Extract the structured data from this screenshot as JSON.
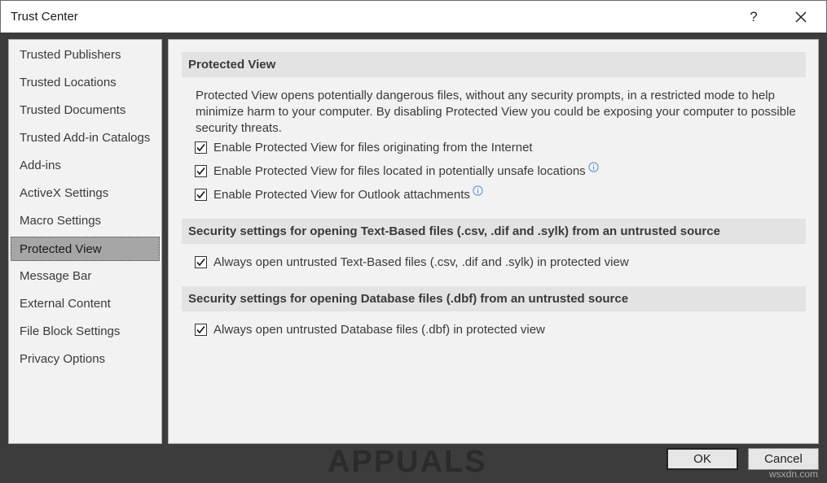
{
  "window": {
    "title": "Trust Center",
    "help_label": "?"
  },
  "sidebar": {
    "items": [
      {
        "label": "Trusted Publishers"
      },
      {
        "label": "Trusted Locations"
      },
      {
        "label": "Trusted Documents"
      },
      {
        "label": "Trusted Add-in Catalogs"
      },
      {
        "label": "Add-ins"
      },
      {
        "label": "ActiveX Settings"
      },
      {
        "label": "Macro Settings"
      },
      {
        "label": "Protected View",
        "selected": true
      },
      {
        "label": "Message Bar"
      },
      {
        "label": "External Content"
      },
      {
        "label": "File Block Settings"
      },
      {
        "label": "Privacy Options"
      }
    ]
  },
  "protected_view": {
    "header": "Protected View",
    "description": "Protected View opens potentially dangerous files, without any security prompts, in a restricted mode to help minimize harm to your computer. By disabling Protected View you could be exposing your computer to possible security threats.",
    "options": [
      {
        "label": "Enable Protected View for files originating from the Internet",
        "checked": true
      },
      {
        "label": "Enable Protected View for files located in potentially unsafe locations",
        "checked": true,
        "info_icon": "info-icon"
      },
      {
        "label": "Enable Protected View for Outlook attachments",
        "checked": true,
        "info_icon": "info-icon"
      }
    ]
  },
  "text_based": {
    "header": "Security settings for opening Text-Based files (.csv, .dif and .sylk) from an untrusted source",
    "option": {
      "label": "Always open untrusted Text-Based files (.csv, .dif and .sylk) in protected view",
      "checked": true
    }
  },
  "database": {
    "header": "Security settings for opening Database files (.dbf) from an untrusted source",
    "option": {
      "label": "Always open untrusted Database files (.dbf) in protected view",
      "checked": true
    }
  },
  "buttons": {
    "ok": "OK",
    "cancel": "Cancel"
  },
  "logo_text": "APPUALS",
  "watermark": "wsxdn.com",
  "colors": {
    "selected_item_bg": "#a6a6a6",
    "section_header_bg": "#e3e3e3",
    "panel_bg": "#f2f2f2",
    "frame_bg": "#3c3c3c",
    "info_icon": "#4a90d9"
  }
}
